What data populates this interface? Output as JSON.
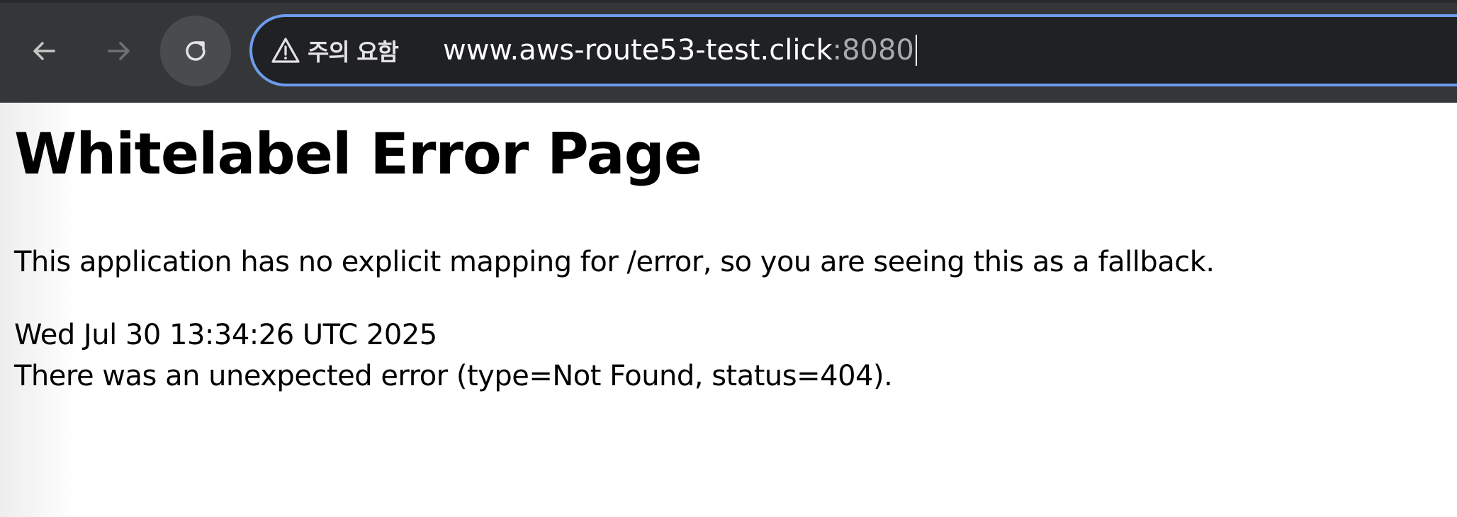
{
  "browser": {
    "security_label": "주의 요함",
    "url_host": "www.aws-route53-test.click",
    "url_port": ":8080",
    "icons": {
      "back": "arrow-left-icon",
      "forward": "arrow-right-icon",
      "reload": "reload-icon",
      "security": "warning-triangle-icon"
    },
    "colors": {
      "toolbar": "#353638",
      "omnibox_border": "#6d9ceb",
      "omnibox_bg": "#202124"
    }
  },
  "page": {
    "title": "Whitelabel Error Page",
    "message": "This application has no explicit mapping for /error, so you are seeing this as a fallback.",
    "timestamp": "Wed Jul 30 13:34:26 UTC 2025",
    "error_detail": "There was an unexpected error (type=Not Found, status=404)."
  }
}
